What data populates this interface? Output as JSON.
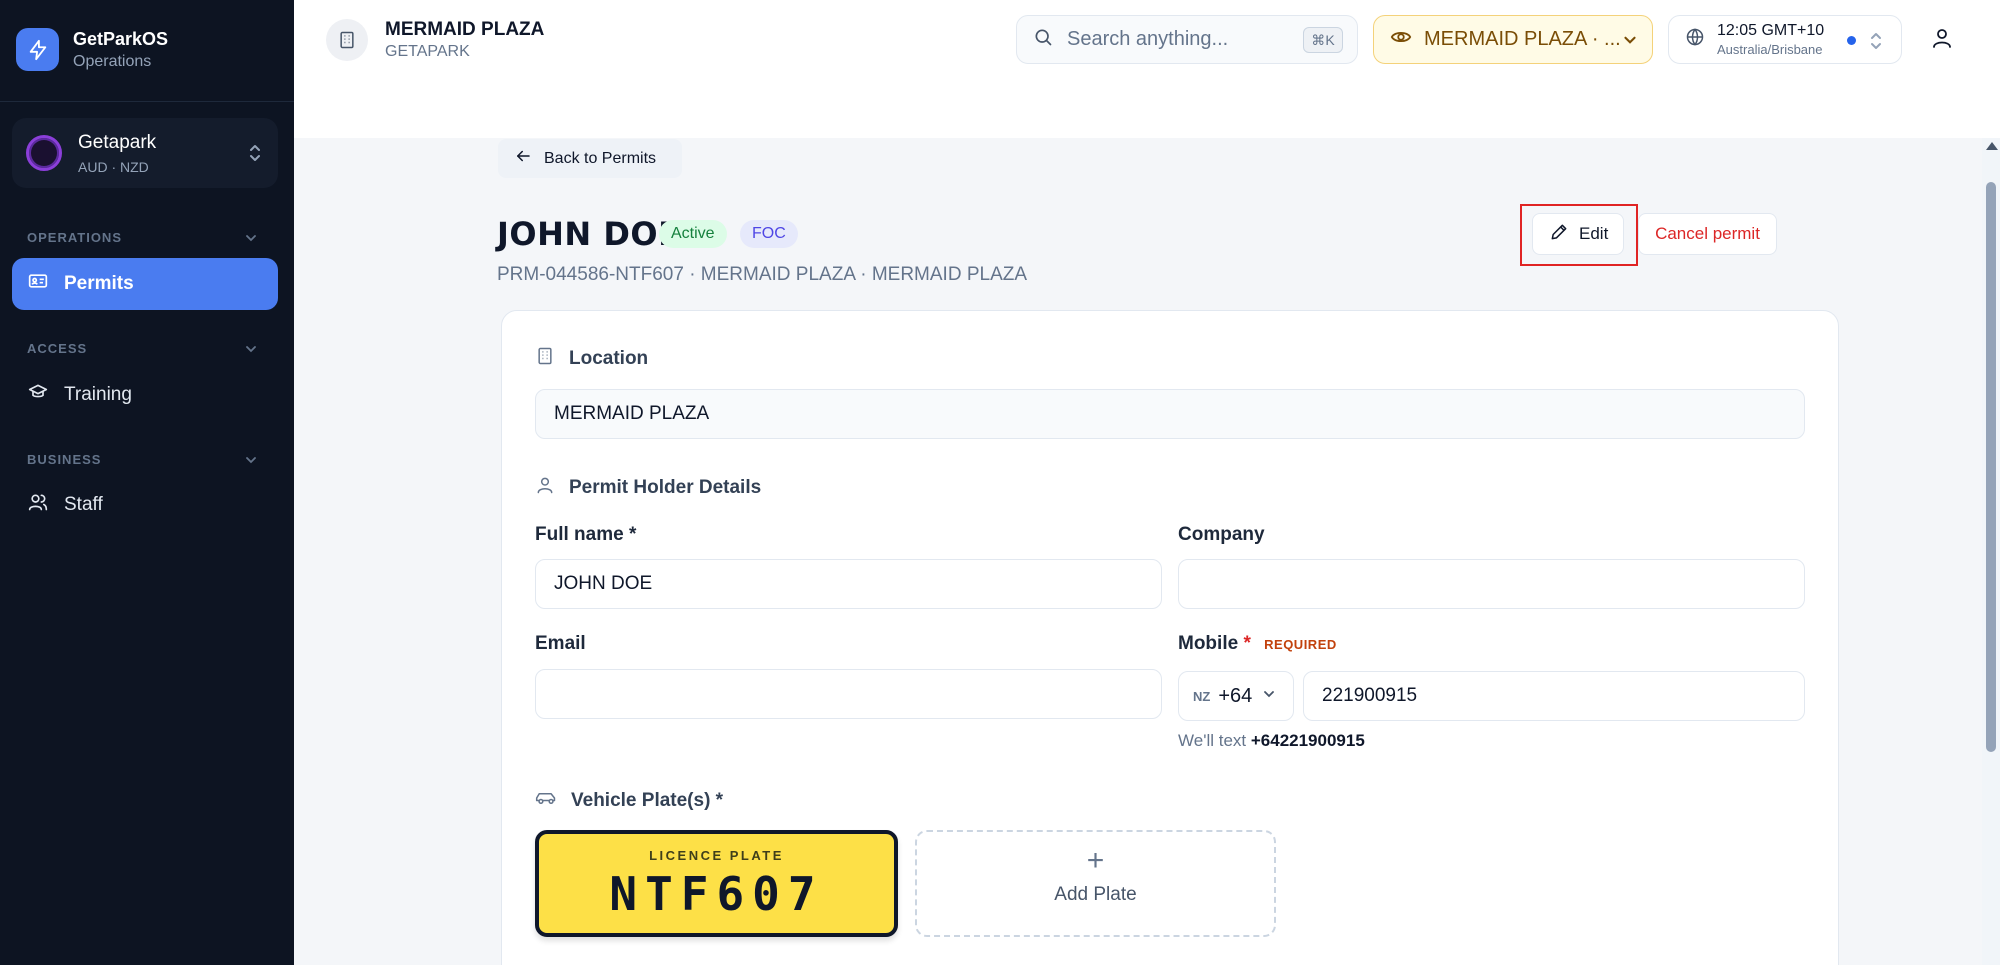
{
  "brand": {
    "name": "GetParkOS",
    "subtitle": "Operations",
    "color": "#4a7cf0"
  },
  "org": {
    "name": "Getapark",
    "currencies": "AUD · NZD"
  },
  "sidebar": {
    "sections": [
      {
        "label": "OPERATIONS",
        "items": [
          {
            "label": "Permits",
            "icon": "id-card-icon",
            "active": true
          }
        ]
      },
      {
        "label": "ACCESS",
        "items": [
          {
            "label": "Training",
            "icon": "graduation-cap-icon",
            "active": false
          }
        ]
      },
      {
        "label": "BUSINESS",
        "items": [
          {
            "label": "Staff",
            "icon": "users-icon",
            "active": false
          }
        ]
      }
    ]
  },
  "topbar": {
    "title": "MERMAID PLAZA",
    "subtitle": "GETAPARK",
    "search_placeholder": "Search anything...",
    "search_shortcut": "⌘K",
    "location_selector": "MERMAID PLAZA · ...",
    "time": "12:05 GMT+10",
    "timezone": "Australia/Brisbane"
  },
  "page": {
    "back_label": "Back to Permits",
    "title": "JOHN DOE",
    "status_badge": "Active",
    "type_badge": "FOC",
    "meta": "PRM-044586-NTF607 · MERMAID PLAZA · MERMAID PLAZA",
    "edit_label": "Edit",
    "cancel_label": "Cancel permit"
  },
  "form": {
    "location_heading": "Location",
    "location_value": "MERMAID PLAZA",
    "holder_heading": "Permit Holder Details",
    "full_name_label": "Full name *",
    "full_name_value": "JOHN DOE",
    "company_label": "Company",
    "company_value": "",
    "email_label": "Email",
    "email_value": "",
    "mobile_label": "Mobile",
    "mobile_star": "*",
    "mobile_required": "REQUIRED",
    "country_code": "NZ",
    "dial_code": "+64",
    "mobile_value": "221900915",
    "hint_prefix": "We'll text",
    "hint_number": "+64221900915",
    "vehicle_heading": "Vehicle Plate(s) *",
    "plate_caption": "LICENCE PLATE",
    "plate_number": "NTF607",
    "add_plate_label": "Add Plate"
  }
}
